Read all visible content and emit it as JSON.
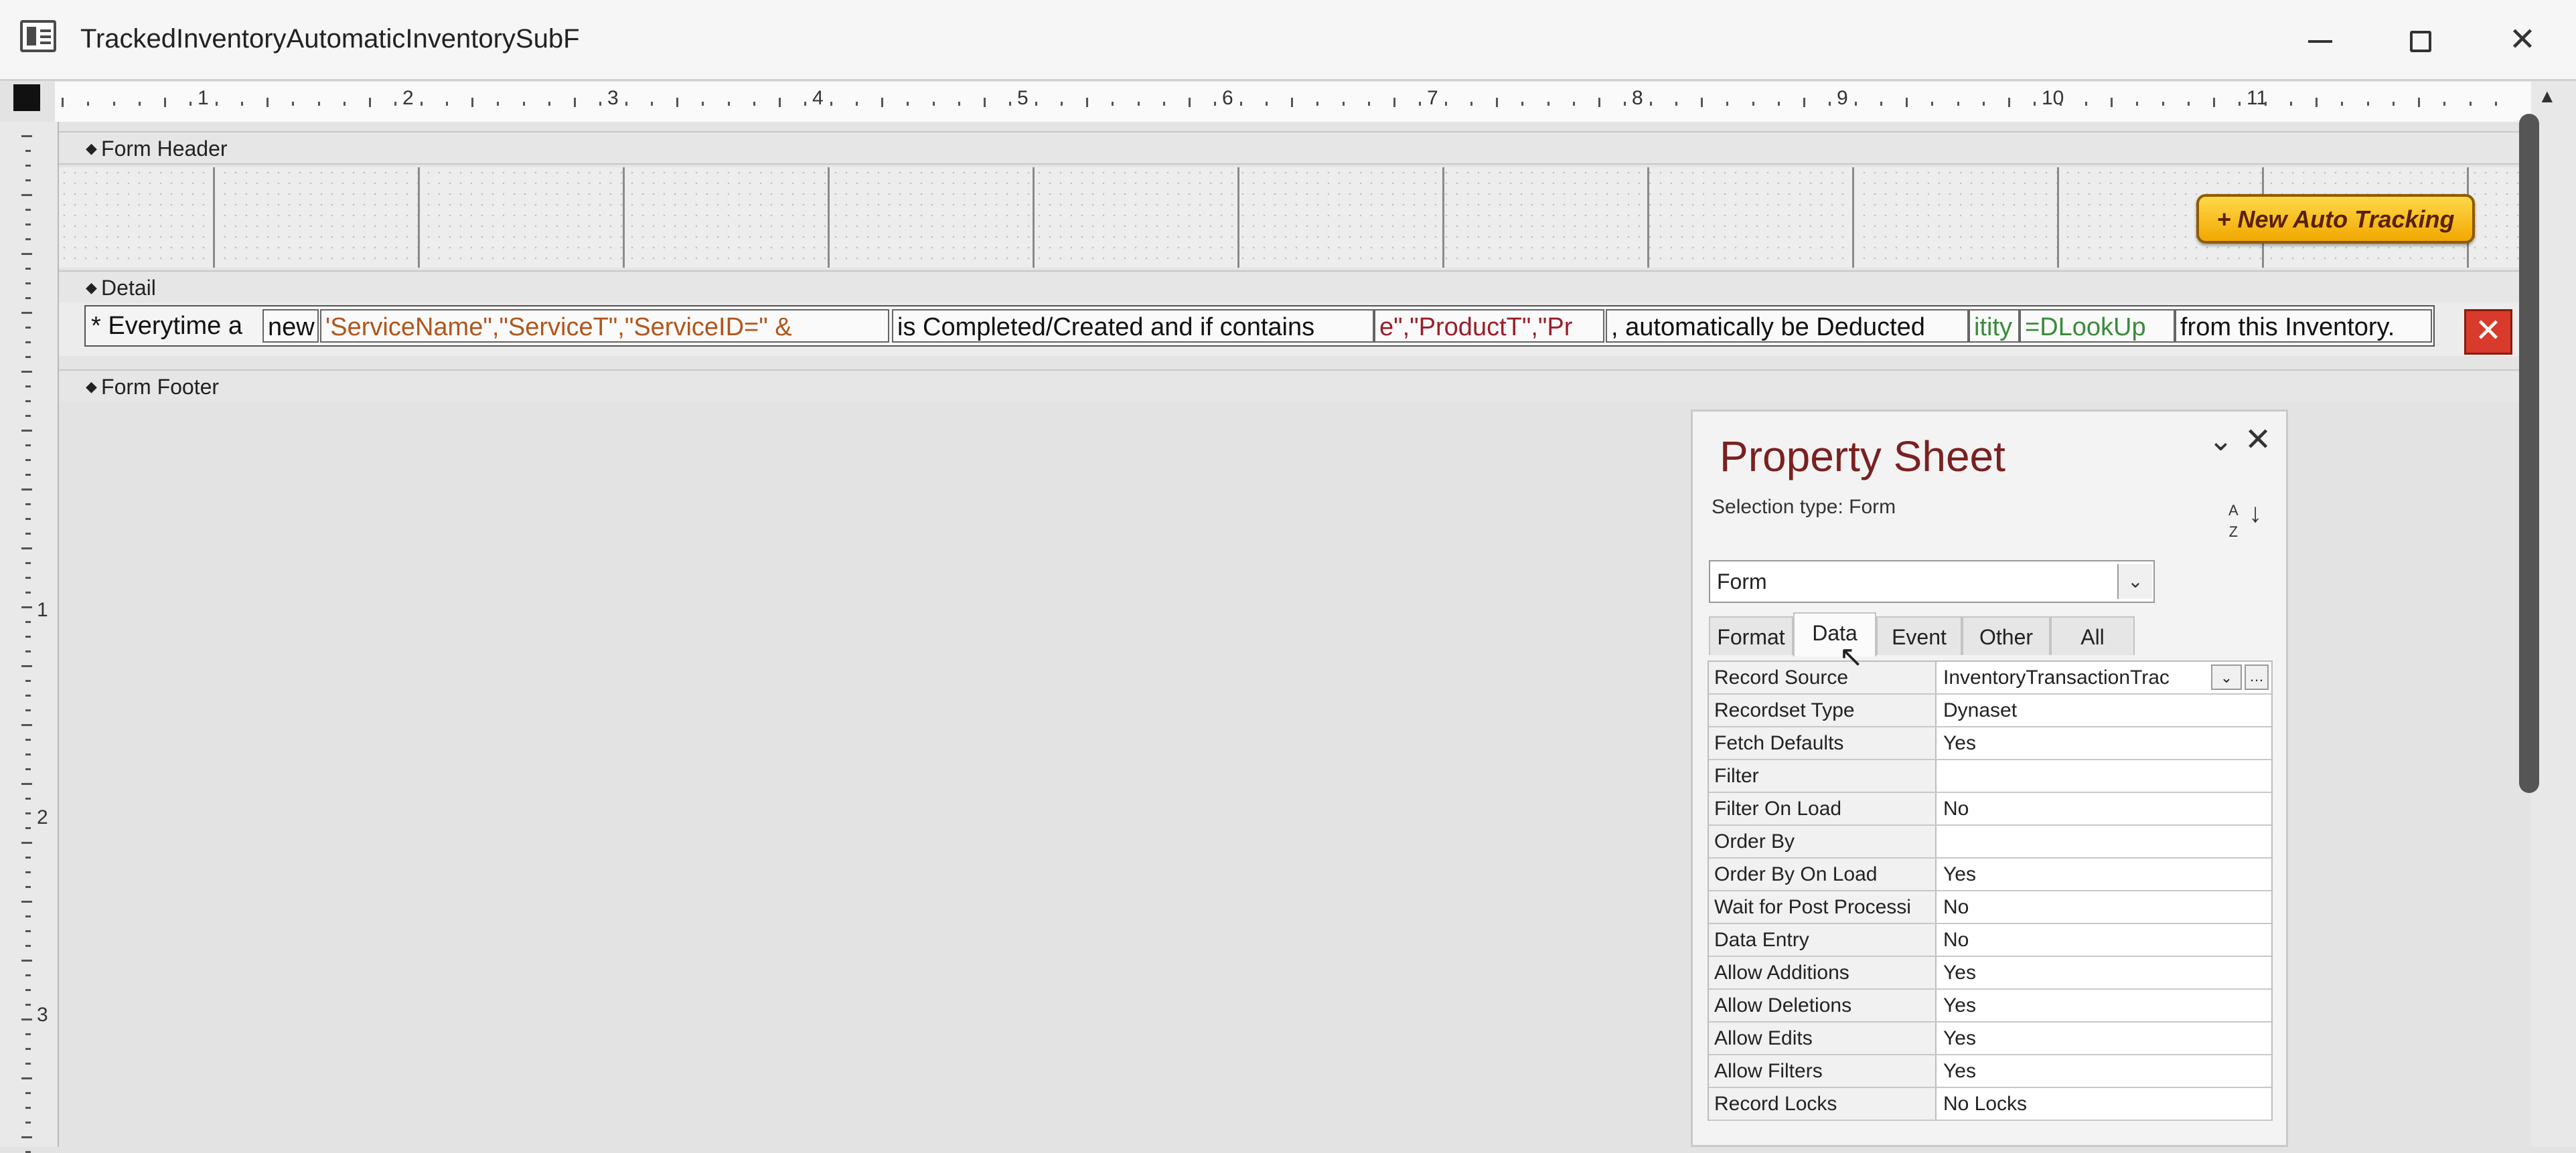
{
  "window": {
    "title": "TrackedInventoryAutomaticInventorySubF",
    "minimize": "–",
    "maximize": "☐",
    "close": "✕"
  },
  "ruler": {
    "horizontal": [
      "1",
      "2",
      "3",
      "4",
      "5",
      "6",
      "7",
      "8",
      "9",
      "10",
      "11"
    ],
    "vertical": [
      "1",
      "2",
      "3"
    ]
  },
  "sections": {
    "header": "Form Header",
    "detail": "Detail",
    "footer": "Form Footer"
  },
  "header_button": {
    "label": "+ New Auto Tracking"
  },
  "detail_controls": [
    {
      "text": "* Everytime a",
      "style": "black"
    },
    {
      "text": "new",
      "style": "black"
    },
    {
      "text": "'ServiceName\",\"ServiceT\",\"ServiceID=\" &",
      "style": "orange"
    },
    {
      "text": "is Completed/Created and if contains",
      "style": "black"
    },
    {
      "text": "e\",\"ProductT\",\"Pr",
      "style": "maroon"
    },
    {
      "text": ", automatically be Deducted",
      "style": "black"
    },
    {
      "text": "itity",
      "style": "green"
    },
    {
      "text": "=DLookUp",
      "style": "green"
    },
    {
      "text": "from this Inventory.",
      "style": "black"
    }
  ],
  "delete_icon": "✕",
  "property_sheet": {
    "title": "Property Sheet",
    "selection_type": "Selection type:  Form",
    "combo_value": "Form",
    "tabs": [
      "Format",
      "Data",
      "Event",
      "Other",
      "All"
    ],
    "active_tab": "Data",
    "rows": [
      {
        "key": "Record Source",
        "value": "InventoryTransactionTrac"
      },
      {
        "key": "Recordset Type",
        "value": "Dynaset"
      },
      {
        "key": "Fetch Defaults",
        "value": "Yes"
      },
      {
        "key": "Filter",
        "value": ""
      },
      {
        "key": "Filter On Load",
        "value": "No"
      },
      {
        "key": "Order By",
        "value": ""
      },
      {
        "key": "Order By On Load",
        "value": "Yes"
      },
      {
        "key": "Wait for Post Processi",
        "value": "No"
      },
      {
        "key": "Data Entry",
        "value": "No"
      },
      {
        "key": "Allow Additions",
        "value": "Yes"
      },
      {
        "key": "Allow Deletions",
        "value": "Yes"
      },
      {
        "key": "Allow Edits",
        "value": "Yes"
      },
      {
        "key": "Allow Filters",
        "value": "Yes"
      },
      {
        "key": "Record Locks",
        "value": "No Locks"
      }
    ]
  }
}
